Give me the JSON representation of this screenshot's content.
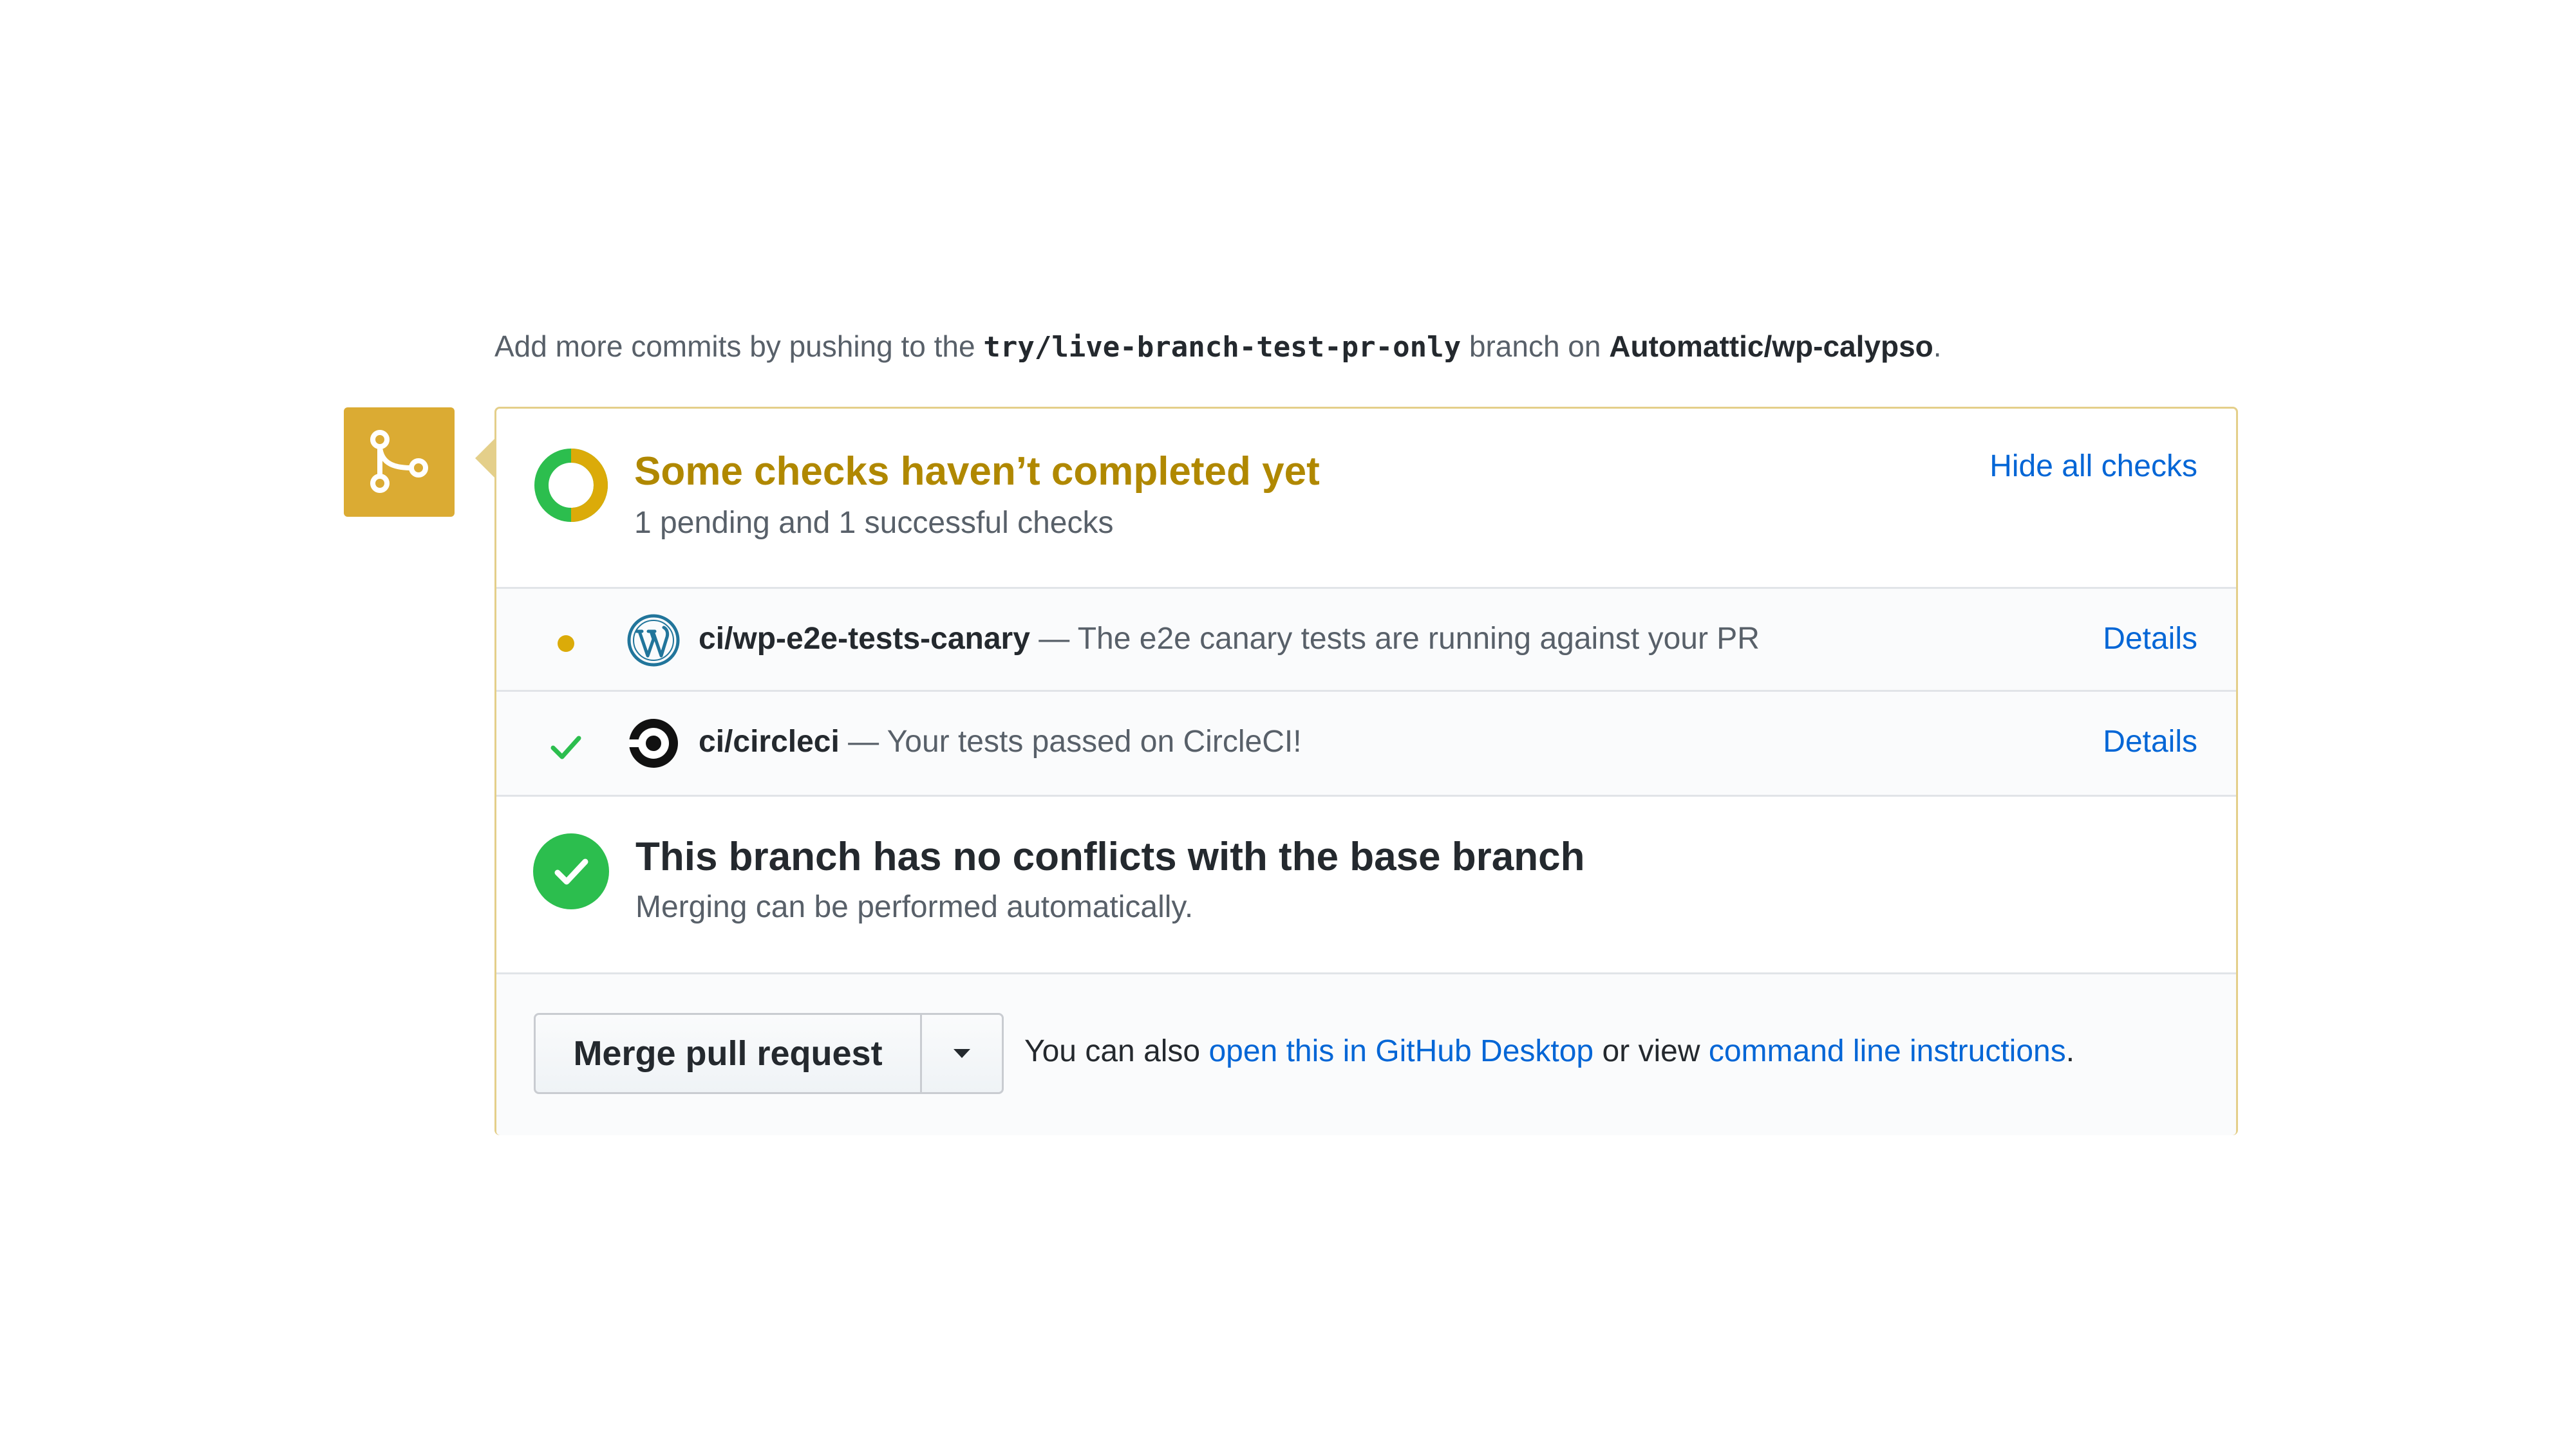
{
  "hint": {
    "prefix": "Add more commits by pushing to the ",
    "branch": "try/live-branch-test-pr-only",
    "middle": " branch on ",
    "repo": "Automattic/wp-calypso",
    "suffix": "."
  },
  "checks_header": {
    "title": "Some checks haven’t completed yet",
    "subtitle": "1 pending and 1 successful checks",
    "toggle_label": "Hide all checks",
    "title_color": "#b08800",
    "pending_ratio": 0.5
  },
  "checks": [
    {
      "status": "pending",
      "icon": "wordpress-icon",
      "context": "ci/wp-e2e-tests-canary",
      "description": " — The e2e canary tests are running against your PR",
      "details_label": "Details"
    },
    {
      "status": "success",
      "icon": "circleci-icon",
      "context": "ci/circleci",
      "description": " — Your tests passed on CircleCI!",
      "details_label": "Details"
    }
  ],
  "conflicts": {
    "title": "This branch has no conflicts with the base branch",
    "subtitle": "Merging can be performed automatically."
  },
  "merge": {
    "button_label": "Merge pull request",
    "text_prefix": "You can also ",
    "desktop_link": "open this in GitHub Desktop",
    "text_middle": " or view ",
    "cli_link": "command line instructions",
    "text_suffix": "."
  },
  "colors": {
    "pending": "#dbab09",
    "success": "#2cbe4e",
    "link": "#0366d6",
    "badge": "#dbab33"
  }
}
